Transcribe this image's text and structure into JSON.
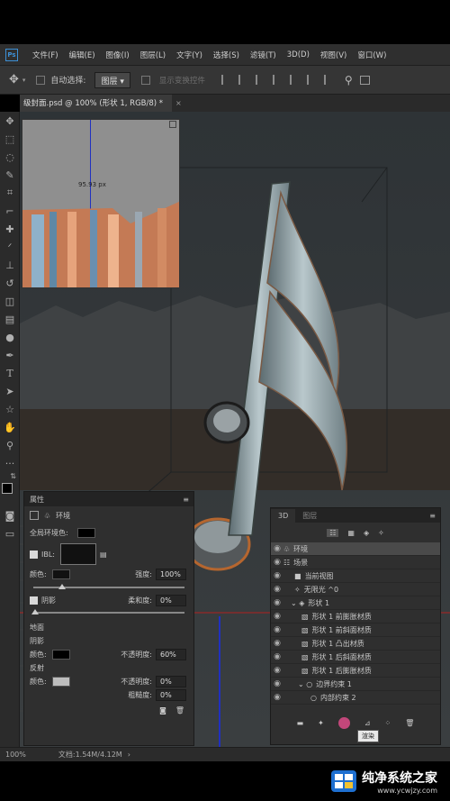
{
  "menubar": {
    "logo": "Ps",
    "items": [
      "文件(F)",
      "编辑(E)",
      "图像(I)",
      "图层(L)",
      "文字(Y)",
      "选择(S)",
      "滤镜(T)",
      "3D(D)",
      "视图(V)",
      "窗口(W)"
    ]
  },
  "options": {
    "auto_select_label": "自动选择:",
    "auto_select_value": "图层",
    "transform_label": "显示变换控件"
  },
  "document": {
    "tab_title": "级封面.psd @ 100% (形状 1, RGB/8) *"
  },
  "canvas": {
    "measure_text": "95.93 px"
  },
  "properties": {
    "title": "属性",
    "section": "环境",
    "global_env_color_label": "全局环境色:",
    "ibl_label": "IBL:",
    "color_label": "颜色:",
    "intensity_label": "强度:",
    "intensity_value": "100%",
    "shadow_label": "阴影",
    "softness_label": "柔和度:",
    "softness_value": "0%",
    "ground_label": "地面",
    "ground_shadow_label": "阴影",
    "shadow_color_label": "颜色:",
    "opacity_label": "不透明度:",
    "opacity_value": "60%",
    "reflection_label": "反射",
    "reflection_color_label": "颜色:",
    "reflection_opacity_label": "不透明度:",
    "reflection_opacity_value": "0%",
    "roughness_label": "粗糙度:",
    "roughness_value": "0%"
  },
  "panel3d": {
    "tabs": [
      "3D",
      "图层"
    ],
    "rows": [
      {
        "label": "环境",
        "indent": 0
      },
      {
        "label": "场景",
        "indent": 0
      },
      {
        "label": "当前视图",
        "indent": 1
      },
      {
        "label": "无限光 ^0",
        "indent": 1
      },
      {
        "label": "形状 1",
        "indent": 1
      },
      {
        "label": "形状 1 前膨胀材质",
        "indent": 2
      },
      {
        "label": "形状 1 前斜面材质",
        "indent": 2
      },
      {
        "label": "形状 1 凸出材质",
        "indent": 2
      },
      {
        "label": "形状 1 后斜面材质",
        "indent": 2
      },
      {
        "label": "形状 1 后膨胀材质",
        "indent": 2
      },
      {
        "label": "边界约束 1",
        "indent": 2
      },
      {
        "label": "内部约束 2",
        "indent": 3
      }
    ],
    "tooltip": "渲染"
  },
  "status": {
    "zoom": "100%",
    "doc": "文档:1.54M/4.12M"
  },
  "watermark": {
    "brand": "纯净系统之家",
    "url": "www.ycwjzy.com"
  },
  "colors": {
    "accent": "#3d8fd4",
    "note_body": "#8fa6ad",
    "note_edge": "#b5662f"
  }
}
